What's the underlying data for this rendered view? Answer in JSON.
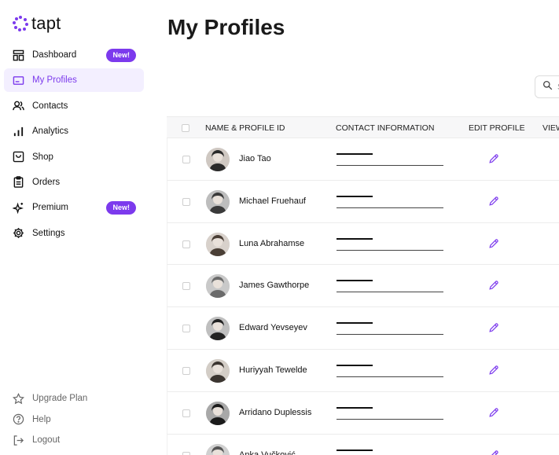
{
  "brand": {
    "name": "tapt",
    "accent": "#7c3aed"
  },
  "sidebar": {
    "items": [
      {
        "label": "Dashboard",
        "icon": "dashboard-icon",
        "badge": "New!"
      },
      {
        "label": "My Profiles",
        "icon": "profile-card-icon",
        "active": true
      },
      {
        "label": "Contacts",
        "icon": "users-icon"
      },
      {
        "label": "Analytics",
        "icon": "bar-chart-icon"
      },
      {
        "label": "Shop",
        "icon": "shop-icon"
      },
      {
        "label": "Orders",
        "icon": "clipboard-icon"
      },
      {
        "label": "Premium",
        "icon": "sparkles-icon",
        "badge": "New!"
      },
      {
        "label": "Settings",
        "icon": "gear-icon"
      }
    ],
    "bottom": [
      {
        "label": "Upgrade Plan",
        "icon": "star-icon"
      },
      {
        "label": "Help",
        "icon": "help-circle-icon"
      },
      {
        "label": "Logout",
        "icon": "logout-icon"
      }
    ]
  },
  "main": {
    "title": "My Profiles",
    "search_placeholder": "S"
  },
  "table": {
    "columns": [
      "NAME & PROFILE ID",
      "CONTACT INFORMATION",
      "EDIT PROFILE",
      "VIEW"
    ],
    "rows": [
      {
        "name": "Jiao Tao"
      },
      {
        "name": "Michael Fruehauf"
      },
      {
        "name": "Luna Abrahamse"
      },
      {
        "name": "James Gawthorpe"
      },
      {
        "name": "Edward Yevseyev"
      },
      {
        "name": "Huriyyah Tewelde"
      },
      {
        "name": "Arridano Duplessis"
      },
      {
        "name": "Anka Vučković"
      }
    ]
  }
}
